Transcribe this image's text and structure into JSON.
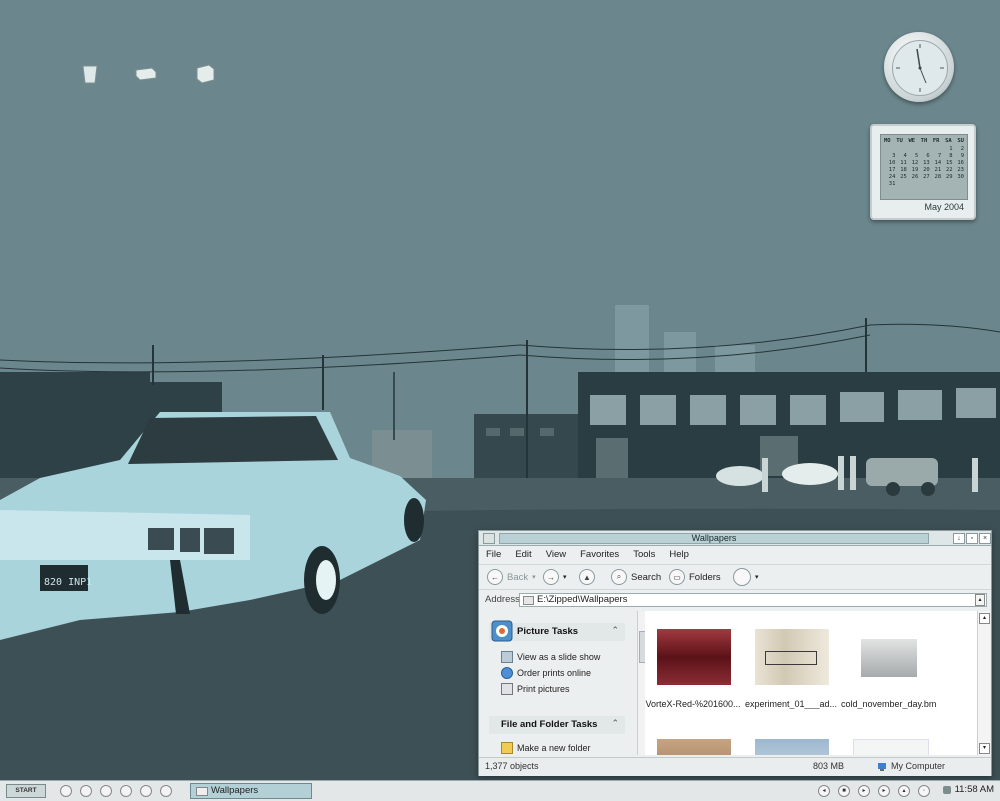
{
  "desktop": {
    "icons": [
      "recycle-bin-icon",
      "drive-icon",
      "box-icon"
    ]
  },
  "widgets": {
    "calendar": {
      "days_of_week": [
        "MO",
        "TU",
        "WE",
        "TH",
        "FR",
        "SA",
        "SU"
      ],
      "days": [
        "",
        "",
        "",
        "",
        "",
        "1",
        "2",
        "3",
        "4",
        "5",
        "6",
        "7",
        "8",
        "9",
        "10",
        "11",
        "12",
        "13",
        "14",
        "15",
        "16",
        "17",
        "18",
        "19",
        "20",
        "21",
        "22",
        "23",
        "24",
        "25",
        "26",
        "27",
        "28",
        "29",
        "30",
        "31",
        "",
        "",
        "",
        "",
        "",
        ""
      ],
      "month_label": "May 2004"
    }
  },
  "window": {
    "title": "Wallpapers",
    "menu": [
      "File",
      "Edit",
      "View",
      "Favorites",
      "Tools",
      "Help"
    ],
    "toolbar": {
      "back": "Back",
      "search": "Search",
      "folders": "Folders"
    },
    "address": {
      "label": "Address",
      "value": "E:\\Zipped\\Wallpapers"
    },
    "picture_tasks": {
      "title": "Picture Tasks",
      "items": [
        "View as a slide show",
        "Order prints online",
        "Print pictures"
      ]
    },
    "file_tasks": {
      "title": "File and Folder Tasks",
      "items": [
        "Make a new folder"
      ]
    },
    "files": [
      {
        "name": "VorteX-Red-%201600...",
        "color": "#7b1e24"
      },
      {
        "name": "experiment_01___ad...",
        "color": "#e6dfcf"
      },
      {
        "name": "cold_november_day.bmp",
        "color": "#b9bcbc"
      }
    ],
    "status": {
      "objects": "1,377 objects",
      "size": "803 MB",
      "location": "My Computer"
    }
  },
  "taskbar": {
    "start_label": "START",
    "task_label": "Wallpapers",
    "time": "11:58 AM"
  },
  "colors": {
    "desktop_bg": "#6b878d",
    "accent": "#b3d0d6"
  }
}
